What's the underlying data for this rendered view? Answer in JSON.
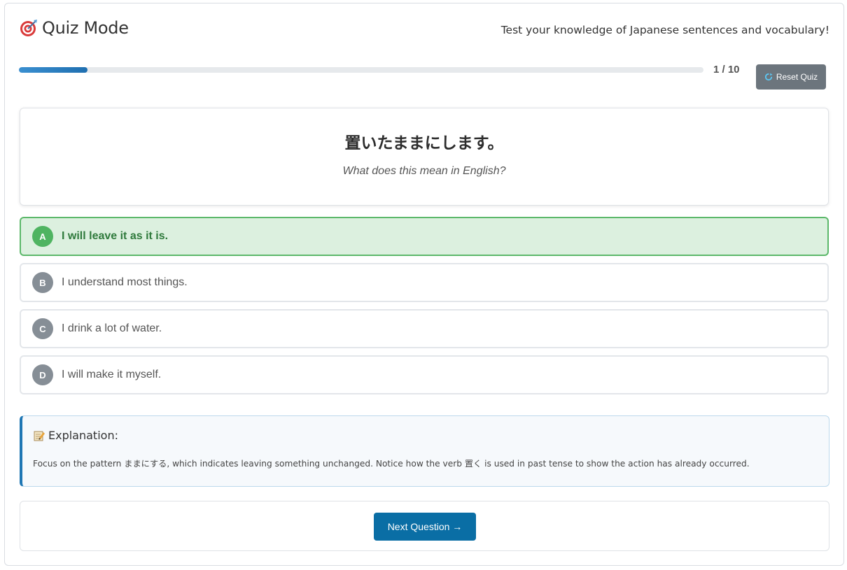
{
  "header": {
    "title": "Quiz Mode",
    "title_icon": "target-icon",
    "subtitle": "Test your knowledge of Japanese sentences and vocabulary!"
  },
  "progress": {
    "label": "1 / 10",
    "current": 1,
    "total": 10,
    "fraction": 0.1
  },
  "reset": {
    "label": "Reset Quiz",
    "icon": "refresh-icon"
  },
  "question": {
    "japanese": "置いたままにします。",
    "prompt": "What does this mean in English?"
  },
  "options": [
    {
      "letter": "A",
      "text": "I will leave it as it is.",
      "state": "correct"
    },
    {
      "letter": "B",
      "text": "I understand most things.",
      "state": "default"
    },
    {
      "letter": "C",
      "text": "I drink a lot of water.",
      "state": "default"
    },
    {
      "letter": "D",
      "text": "I will make it myself.",
      "state": "default"
    }
  ],
  "explanation": {
    "icon": "memo-icon",
    "title": "Explanation:",
    "body": "Focus on the pattern ままにする, which indicates leaving something unchanged. Notice how the verb 置く is used in past tense to show the action has already occurred."
  },
  "next": {
    "label": "Next Question →"
  },
  "colors": {
    "accent": "#0a6ea5",
    "progress": "#2f84c6",
    "correct_bg": "#dcf0df",
    "correct_border": "#5cb86a",
    "correct_badge": "#4fb461",
    "neutral_badge": "#868e96",
    "reset_bg": "#6c757d"
  }
}
